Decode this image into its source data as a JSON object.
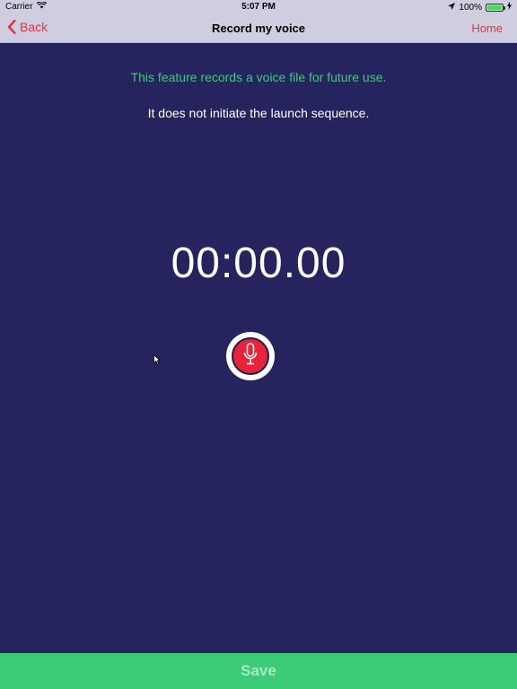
{
  "status_bar": {
    "carrier": "Carrier",
    "time": "5:07 PM",
    "battery": "100%",
    "battery_level": 1.0
  },
  "nav": {
    "back_label": "Back",
    "title": "Record my voice",
    "home_label": "Home"
  },
  "info": {
    "line1": "This feature records a voice file for future use.",
    "line2": "It does not initiate the launch sequence."
  },
  "timer": "00:00.00",
  "save_label": "Save",
  "colors": {
    "background": "#25245f",
    "nav_bar": "#cfcde0",
    "accent_red": "#e8333f",
    "accent_green": "#3ccb77"
  },
  "icons": {
    "back": "chevron-left-icon",
    "record": "microphone-icon",
    "wifi": "wifi-icon",
    "location": "location-arrow-icon",
    "battery": "battery-icon",
    "cursor": "mouse-cursor-icon"
  }
}
